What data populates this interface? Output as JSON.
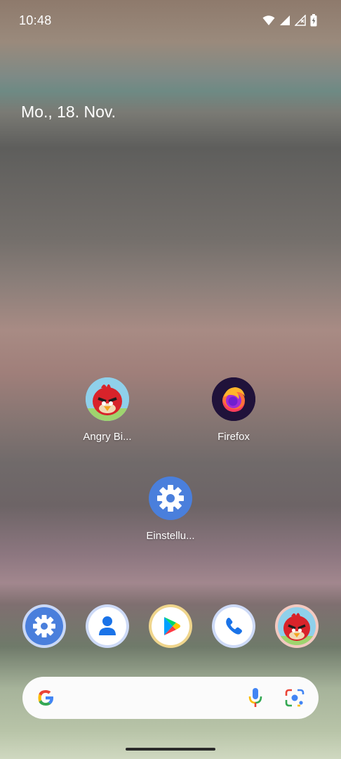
{
  "status_bar": {
    "time": "10:48",
    "icons": [
      "wifi-icon",
      "signal-icon",
      "no-signal-icon",
      "battery-charging-icon"
    ]
  },
  "home": {
    "date": "Mo., 18. Nov.",
    "apps": [
      {
        "label": "Angry Bi...",
        "icon": "angry-birds-icon"
      },
      {
        "label": "Firefox",
        "icon": "firefox-icon"
      },
      {
        "label": "Einstellu...",
        "icon": "settings-gear-icon"
      }
    ]
  },
  "dock": [
    "settings-icon",
    "contacts-icon",
    "play-store-icon",
    "phone-icon",
    "angry-birds-icon"
  ],
  "search": {
    "icons": [
      "google-g-icon",
      "microphone-icon",
      "google-lens-icon"
    ]
  },
  "colors": {
    "settings_blue": "#4a7fdc",
    "firefox_bg": "#20123a",
    "dock_ring": "#cddaf7"
  }
}
